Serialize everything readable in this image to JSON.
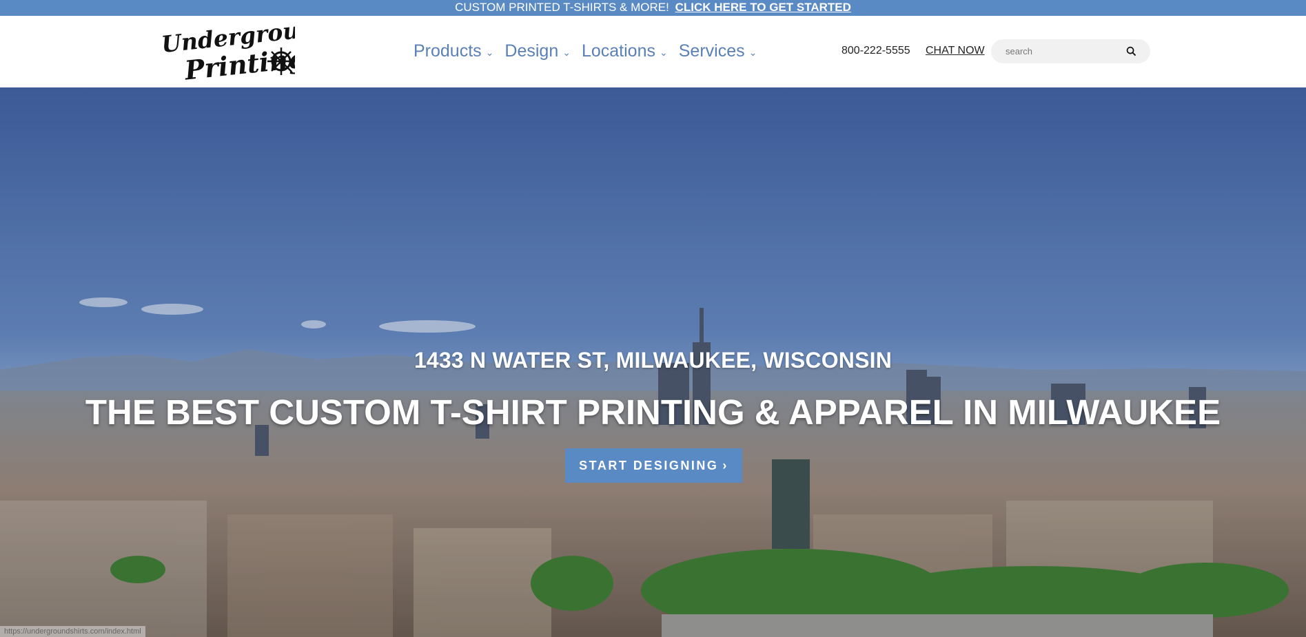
{
  "promo": {
    "text": "CUSTOM PRINTED T-SHIRTS & MORE!",
    "link": "CLICK HERE TO GET STARTED"
  },
  "logo": {
    "line1": "Underground",
    "line2": "Printing"
  },
  "nav": [
    {
      "label": "Products"
    },
    {
      "label": "Design"
    },
    {
      "label": "Locations"
    },
    {
      "label": "Services"
    }
  ],
  "header": {
    "phone": "800-222-5555",
    "chat": "CHAT NOW"
  },
  "search": {
    "placeholder": "search"
  },
  "hero": {
    "address": "1433 N WATER ST, MILWAUKEE, WISCONSIN",
    "headline": "THE BEST CUSTOM T-SHIRT PRINTING & APPAREL IN MILWAUKEE",
    "cta": "START DESIGNING",
    "status_url": "https://undergroundshirts.com/index.html"
  },
  "colors": {
    "brand": "#5a8ac4",
    "nav": "#5a80b7"
  }
}
